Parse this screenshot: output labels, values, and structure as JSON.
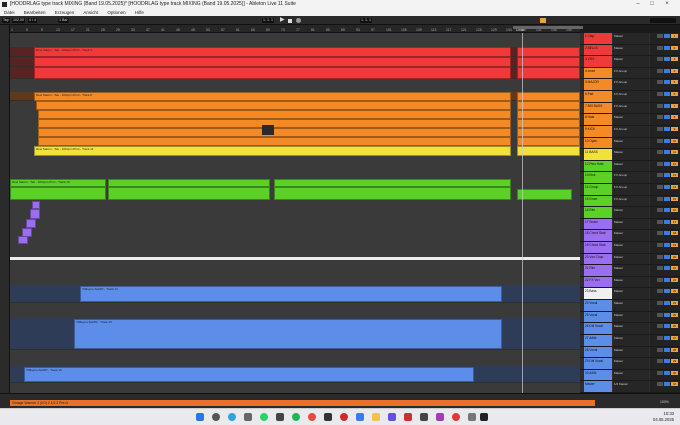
{
  "window": {
    "title": "[HOODRLAG type track MIXING (Band 19.05.2025)* [HOODRLAG type track MIXING (Band 19.05.2025)] - Ableton Live 11 Suite"
  },
  "menu": [
    "Datei",
    "Bearbeiten",
    "Erzeugen",
    "Ansicht",
    "Optionen",
    "Hilfe"
  ],
  "control": {
    "tap": "Tap",
    "tempo": "102.00",
    "signature": "4 / 4",
    "quantize": "1 Bar",
    "position": "1. 1. 1",
    "loop_length": "1. 1. 1"
  },
  "ruler": {
    "marks": [
      "1",
      "5",
      "9",
      "13",
      "17",
      "21",
      "25",
      "29",
      "33",
      "37",
      "41",
      "45",
      "49",
      "53",
      "57",
      "61",
      "65",
      "69",
      "73",
      "77",
      "81",
      "85",
      "89",
      "93",
      "97",
      "101",
      "105",
      "109",
      "113",
      "117",
      "121",
      "125",
      "129",
      "133",
      "137",
      "141",
      "145",
      "149"
    ],
    "loop_label": "LOOP"
  },
  "clip_labels": {
    "red": "Row Saturn - Tek - 101bpm Print - Track 3",
    "orange": "Row Saturn - Tek - 101bpm Print - Track 8",
    "yellow": "Row Saturn - Tek - 101bpm Print - Track 11",
    "green": "Row Saturn - Tek - 101bpm Print - Track 13",
    "blue1": "7kBaynu-Sub8V - Track 14",
    "blue2": "7kBaynu-Sub8V - Track 15",
    "blue3": "7kBaynu-Sub8V - Track 16"
  },
  "tracks": [
    {
      "name": "1 Clap",
      "color": "#f03a3a",
      "routing": "Master",
      "num": "1"
    },
    {
      "name": "2 BELLS",
      "color": "#f03a3a",
      "routing": "Master",
      "num": "2"
    },
    {
      "name": "3 VOX",
      "color": "#f03a3a",
      "routing": "Master",
      "num": "3"
    },
    {
      "name": "4 Lead",
      "color": "#f38a25",
      "routing": "FX-Group",
      "num": "4"
    },
    {
      "name": "5 MAJOR",
      "color": "#f38a25",
      "routing": "FX-Group",
      "num": "5"
    },
    {
      "name": "6 Pad",
      "color": "#f38a25",
      "routing": "FX-Group",
      "num": "6"
    },
    {
      "name": "7 808 BASS",
      "color": "#f38a25",
      "routing": "FX-Group",
      "num": "7"
    },
    {
      "name": "8 Hats",
      "color": "#f38a25",
      "routing": "Master",
      "num": "8"
    },
    {
      "name": "9 KICK",
      "color": "#f38a25",
      "routing": "FX-Group",
      "num": "9"
    },
    {
      "name": "10 Open",
      "color": "#f38a25",
      "routing": "Master",
      "num": "10"
    },
    {
      "name": "11 BASS",
      "color": "#f1e13a",
      "routing": "Master",
      "num": "11"
    },
    {
      "name": "12 Perc Hats",
      "color": "#5bd026",
      "routing": "Master",
      "num": "12"
    },
    {
      "name": "13 Kick",
      "color": "#5bd026",
      "routing": "FX-Group",
      "num": "13"
    },
    {
      "name": "14 Group",
      "color": "#5bd026",
      "routing": "FX-Group",
      "num": "14"
    },
    {
      "name": "15 Drum",
      "color": "#5bd026",
      "routing": "FX-Group",
      "num": "15"
    },
    {
      "name": "16 Rim",
      "color": "#5bd026",
      "routing": "Master",
      "num": "16"
    },
    {
      "name": "17 Snare",
      "color": "#9b6df0",
      "routing": "Master",
      "num": "17"
    },
    {
      "name": "18 Chord Stab",
      "color": "#9b6df0",
      "routing": "Master",
      "num": "18"
    },
    {
      "name": "19 Chord Stab",
      "color": "#9b6df0",
      "routing": "Master",
      "num": "19"
    },
    {
      "name": "20 Vox Chop",
      "color": "#9b6df0",
      "routing": "Master",
      "num": "20"
    },
    {
      "name": "21 Rim",
      "color": "#9b6df0",
      "routing": "Master",
      "num": "21"
    },
    {
      "name": "22 FX Vox",
      "color": "#9b6df0",
      "routing": "Master",
      "num": "22"
    },
    {
      "name": "23 Bass",
      "color": "#f0f0f0",
      "routing": "Master",
      "num": "23"
    },
    {
      "name": "24 Vocal",
      "color": "#5c8de8",
      "routing": "Master",
      "num": "24"
    },
    {
      "name": "25 Vocal",
      "color": "#5c8de8",
      "routing": "Master",
      "num": "25"
    },
    {
      "name": "26 Dbl Vocal",
      "color": "#5c8de8",
      "routing": "Master",
      "num": "26"
    },
    {
      "name": "27 Adlib",
      "color": "#5c8de8",
      "routing": "Master",
      "num": "27"
    },
    {
      "name": "28 Vocal",
      "color": "#5c8de8",
      "routing": "Master",
      "num": "28"
    },
    {
      "name": "29 Dbl Vocal",
      "color": "#5c8de8",
      "routing": "Master",
      "num": "29"
    },
    {
      "name": "30 Adlib",
      "color": "#5c8de8",
      "routing": "Master",
      "num": "30"
    },
    {
      "name": "Master",
      "color": "#5c8de8",
      "routing": "1/2 Master",
      "num": "M"
    }
  ],
  "status": {
    "message": "Vintage Warmer 2 (I/O) 2.1/2.3 Pre-fx"
  },
  "zoom": "100%",
  "taskbar": {
    "time": "10:33",
    "date": "04.05.2025"
  },
  "colors": {
    "red": "#f03a3a",
    "orange": "#f38a25",
    "yellow": "#f1e13a",
    "green": "#5bd026",
    "purple": "#9b6df0",
    "blue": "#5c8de8",
    "status": "#e8722a"
  }
}
